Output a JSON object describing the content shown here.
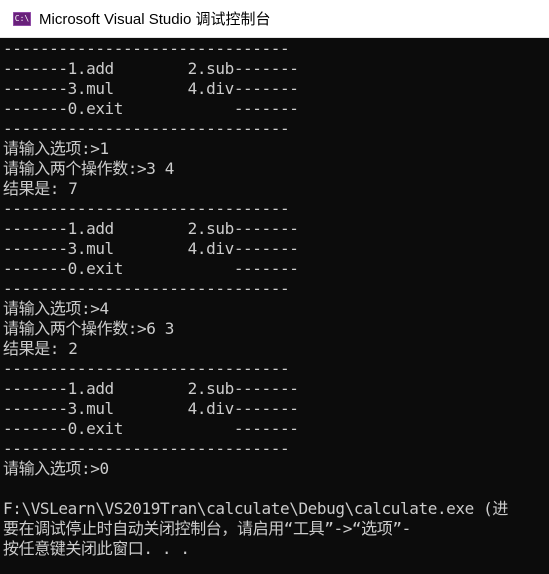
{
  "window": {
    "icon_text": "C:\\",
    "title": "Microsoft Visual Studio 调试控制台"
  },
  "console": {
    "lines": [
      "-------------------------------",
      "-------1.add        2.sub-------",
      "-------3.mul        4.div-------",
      "-------0.exit            -------",
      "-------------------------------",
      "请输入选项:>1",
      "请输入两个操作数:>3 4",
      "结果是: 7",
      "-------------------------------",
      "-------1.add        2.sub-------",
      "-------3.mul        4.div-------",
      "-------0.exit            -------",
      "-------------------------------",
      "请输入选项:>4",
      "请输入两个操作数:>6 3",
      "结果是: 2",
      "-------------------------------",
      "-------1.add        2.sub-------",
      "-------3.mul        4.div-------",
      "-------0.exit            -------",
      "-------------------------------",
      "请输入选项:>0",
      "",
      "F:\\VSLearn\\VS2019Tran\\calculate\\Debug\\calculate.exe (进",
      "要在调试停止时自动关闭控制台，请启用“工具”->“选项”-",
      "按任意键关闭此窗口. . ."
    ]
  },
  "colors": {
    "console_bg": "#0c0c0c",
    "console_text": "#cccccc",
    "title_bg": "#ffffff",
    "icon_bg": "#68217a"
  }
}
